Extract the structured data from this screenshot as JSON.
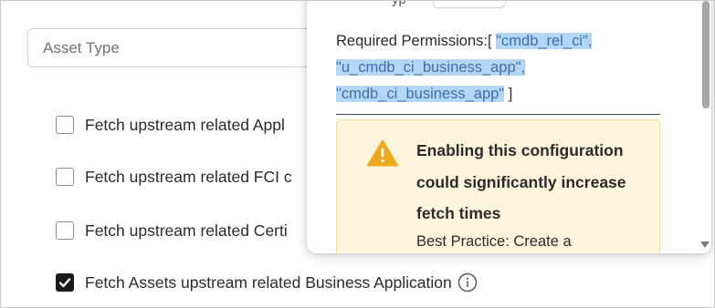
{
  "asset_type": {
    "placeholder": "Asset Type"
  },
  "checkboxes": [
    {
      "label": "Fetch upstream related Appl",
      "checked": false
    },
    {
      "label": "Fetch upstream related FCI c",
      "checked": false
    },
    {
      "label": "Fetch upstream related Certi",
      "checked": false
    },
    {
      "label": "Fetch Assets upstream related Business Application",
      "checked": true
    }
  ],
  "popover": {
    "top_partial_text": "yp",
    "permissions_label": "Required Permissions:[",
    "permissions": [
      "\"cmdb_rel_ci\",",
      "\"u_cmdb_ci_business_app\",",
      "\"cmdb_ci_business_app\""
    ],
    "permissions_close": " ]",
    "warning": {
      "title": "Enabling this configuration could significantly increase fetch times",
      "subtext": "Best Practice: Create a"
    }
  },
  "icons": {
    "info": "info-circle-icon",
    "warning": "warning-triangle-icon",
    "check": "checkmark-icon"
  },
  "colors": {
    "warning_accent": "#f0a91a",
    "warning_bg": "#fdf6dc",
    "selection_bg": "#b4d7f7",
    "selection_text": "#3d6fa8"
  }
}
